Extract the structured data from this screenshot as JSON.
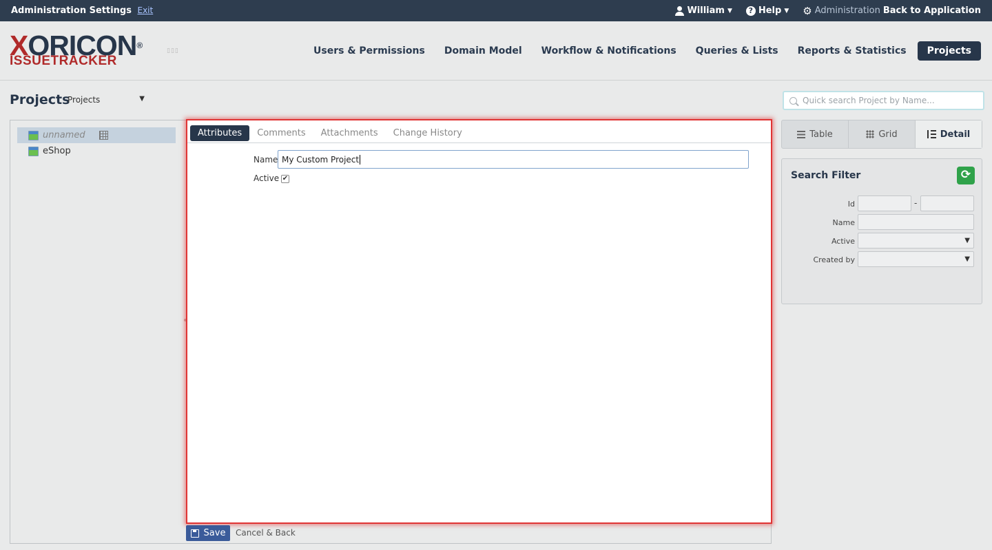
{
  "topbar": {
    "title": "Administration Settings",
    "exit_label": "Exit",
    "user_label": "William",
    "help_label": "Help",
    "admin_label": "Administration",
    "back_label": "Back to Application"
  },
  "logo": {
    "brand_x": "X",
    "brand_rest": "ORICON",
    "reg_mark": "®",
    "subtitle": "ISSUETRACKER"
  },
  "nav": {
    "items": [
      {
        "label": "Users & Permissions",
        "active": false
      },
      {
        "label": "Domain Model",
        "active": false
      },
      {
        "label": "Workflow & Notifications",
        "active": false
      },
      {
        "label": "Queries & Lists",
        "active": false
      },
      {
        "label": "Reports & Statistics",
        "active": false
      },
      {
        "label": "Projects",
        "active": true
      }
    ]
  },
  "page": {
    "title": "Projects",
    "select_value": "Projects",
    "quick_search_placeholder": "Quick search Project by Name..."
  },
  "tree": {
    "items": [
      {
        "label": "unnamed",
        "selected": true
      },
      {
        "label": "eShop",
        "selected": false
      }
    ]
  },
  "detail": {
    "tabs": [
      "Attributes",
      "Comments",
      "Attachments",
      "Change History"
    ],
    "active_tab": "Attributes",
    "name_label": "Name",
    "name_value": "My Custom Project",
    "active_label": "Active",
    "active_checked": true
  },
  "actions": {
    "save_label": "Save",
    "cancel_label": "Cancel & Back"
  },
  "views": {
    "table_label": "Table",
    "grid_label": "Grid",
    "detail_label": "Detail",
    "active": "Detail"
  },
  "filter": {
    "title": "Search Filter",
    "id_label": "Id",
    "id_separator": "-",
    "name_label": "Name",
    "active_label": "Active",
    "created_by_label": "Created by"
  },
  "colors": {
    "topbar_bg": "#2e3d4f",
    "accent": "#27364a",
    "brand_red": "#b02a2a",
    "highlight_border": "#e03434",
    "refresh_green": "#2fa24a"
  }
}
